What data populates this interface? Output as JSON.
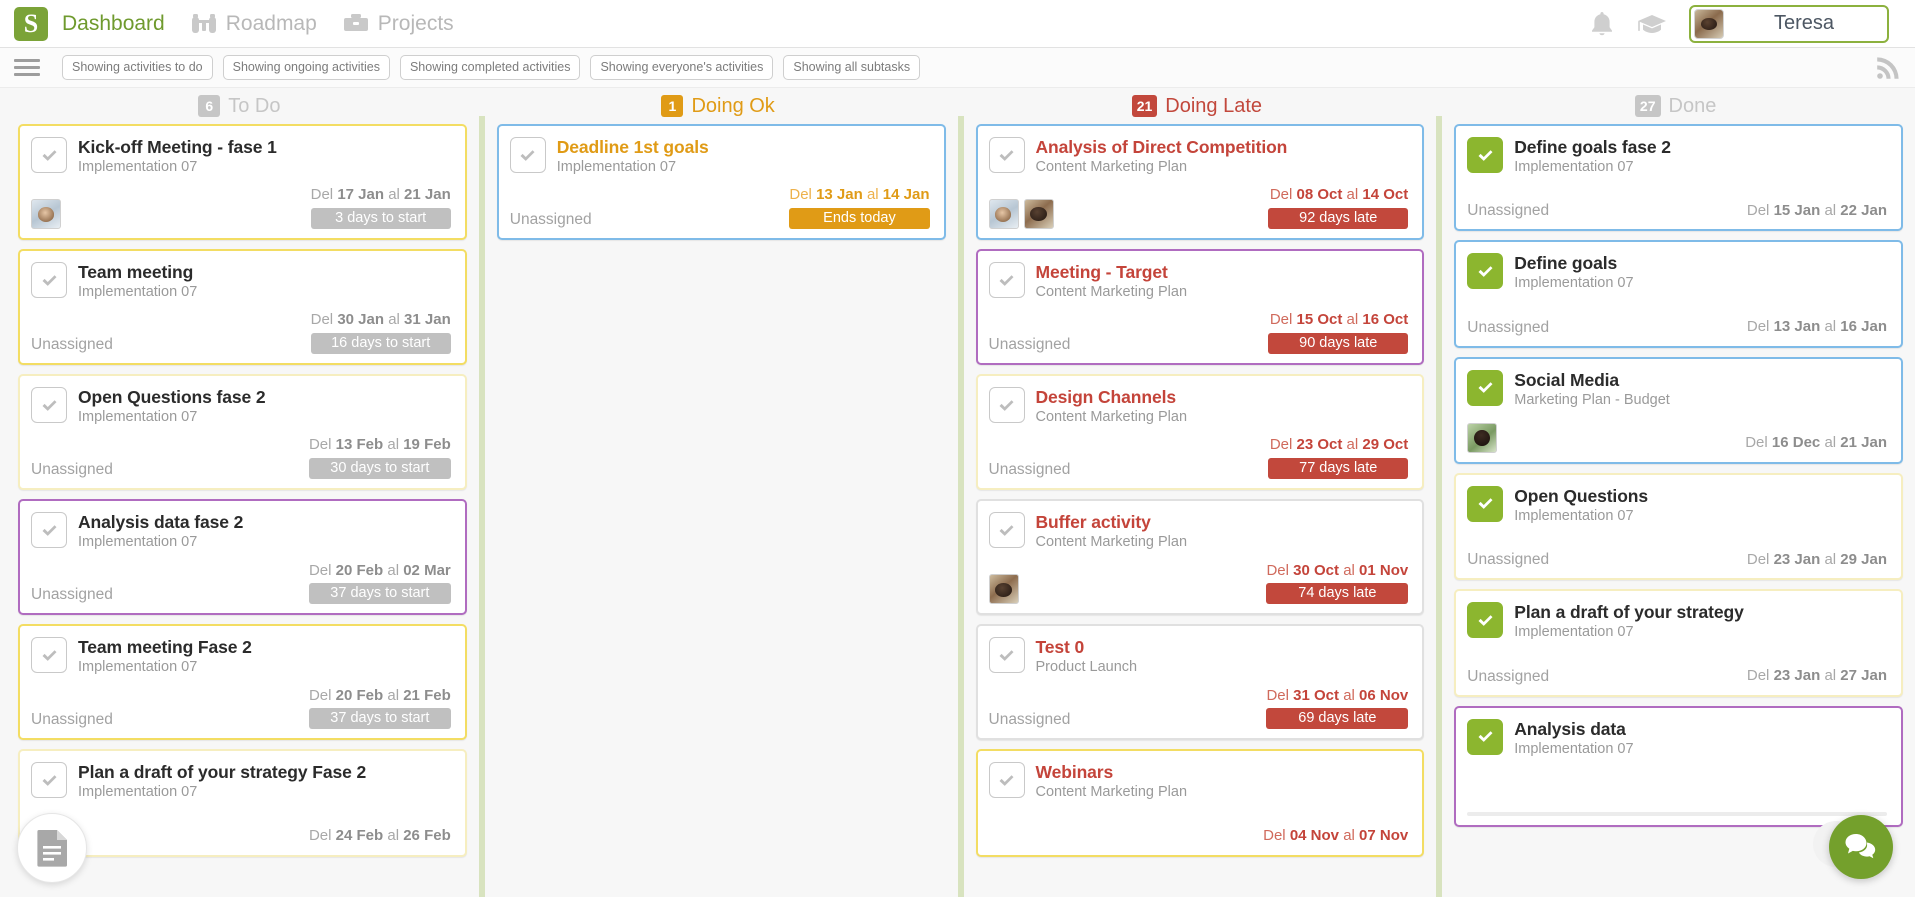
{
  "topnav": {
    "logo_text": "S",
    "items": [
      {
        "label": "Dashboard",
        "icon": "dashboard-logo-icon",
        "active": true
      },
      {
        "label": "Roadmap",
        "icon": "binoculars-icon",
        "active": false
      },
      {
        "label": "Projects",
        "icon": "briefcase-icon",
        "active": false
      }
    ],
    "bell_icon": "bell-icon",
    "graduation_icon": "graduation-cap-icon",
    "user_name": "Teresa"
  },
  "filterbar": {
    "menu_icon": "hamburger-menu-icon",
    "rss_icon": "rss-feed-icon",
    "chips": [
      "Showing activities to do",
      "Showing ongoing activities",
      "Showing completed activities",
      "Showing everyone's activities",
      "Showing all subtasks"
    ]
  },
  "colors": {
    "brand_green": "#7ba338",
    "todo_grey": "#c6c6c6",
    "doing_ok_orange": "#e09b16",
    "doing_late_red": "#c2483c",
    "done_grey": "#c6c6c6",
    "divider_green": "#d8e3bf"
  },
  "columns": [
    {
      "id": "to-do",
      "title": "To Do",
      "count": "6",
      "count_bg": "#c6c6c6",
      "title_color": "#c6c6c6",
      "cards": [
        {
          "title": "Kick-off Meeting - fase 1",
          "project": "Implementation 07",
          "title_tone": "normal",
          "border": "b-yellow",
          "checked": false,
          "assignees": [
            "av-a"
          ],
          "assigned_label": "",
          "date_prefix": "Del",
          "date_from": "17 Jan",
          "date_mid": "al",
          "date_to": "21 Jan",
          "date_tone": "normal",
          "badge": "3 days to start",
          "badge_tone": "grey"
        },
        {
          "title": "Team meeting",
          "project": "Implementation 07",
          "title_tone": "normal",
          "border": "b-yellow",
          "checked": false,
          "assignees": [],
          "assigned_label": "Unassigned",
          "date_prefix": "Del",
          "date_from": "30 Jan",
          "date_mid": "al",
          "date_to": "31 Jan",
          "date_tone": "normal",
          "badge": "16 days to start",
          "badge_tone": "grey"
        },
        {
          "title": "Open Questions fase 2",
          "project": "Implementation 07",
          "title_tone": "normal",
          "border": "b-paleyellow",
          "checked": false,
          "assignees": [],
          "assigned_label": "Unassigned",
          "date_prefix": "Del",
          "date_from": "13 Feb",
          "date_mid": "al",
          "date_to": "19 Feb",
          "date_tone": "normal",
          "badge": "30 days to start",
          "badge_tone": "grey"
        },
        {
          "title": "Analysis data fase 2",
          "project": "Implementation 07",
          "title_tone": "normal",
          "border": "b-purple",
          "checked": false,
          "assignees": [],
          "assigned_label": "Unassigned",
          "date_prefix": "Del",
          "date_from": "20 Feb",
          "date_mid": "al",
          "date_to": "02 Mar",
          "date_tone": "normal",
          "badge": "37 days to start",
          "badge_tone": "grey"
        },
        {
          "title": "Team meeting Fase 2",
          "project": "Implementation 07",
          "title_tone": "normal",
          "border": "b-yellow",
          "checked": false,
          "assignees": [],
          "assigned_label": "Unassigned",
          "date_prefix": "Del",
          "date_from": "20 Feb",
          "date_mid": "al",
          "date_to": "21 Feb",
          "date_tone": "normal",
          "badge": "37 days to start",
          "badge_tone": "grey"
        },
        {
          "title": "Plan a draft of your strategy Fase 2",
          "project": "Implementation 07",
          "title_tone": "normal",
          "border": "b-paleyellow",
          "checked": false,
          "assignees": [],
          "assigned_label": "",
          "date_prefix": "Del",
          "date_from": "24 Feb",
          "date_mid": "al",
          "date_to": "26 Feb",
          "date_tone": "normal",
          "badge": "",
          "badge_tone": "grey"
        }
      ]
    },
    {
      "id": "doing-ok",
      "title": "Doing Ok",
      "count": "1",
      "count_bg": "#e09b16",
      "title_color": "#e09b16",
      "cards": [
        {
          "title": "Deadline 1st goals",
          "project": "Implementation 07",
          "title_tone": "ok",
          "border": "b-blue",
          "checked": false,
          "assignees": [],
          "assigned_label": "Unassigned",
          "date_prefix": "Del",
          "date_from": "13 Jan",
          "date_mid": "al",
          "date_to": "14 Jan",
          "date_tone": "ok",
          "badge": "Ends today",
          "badge_tone": "orange"
        }
      ]
    },
    {
      "id": "doing-late",
      "title": "Doing Late",
      "count": "21",
      "count_bg": "#c2483c",
      "title_color": "#c2483c",
      "cards": [
        {
          "title": "Analysis of Direct Competition",
          "project": "Content Marketing Plan",
          "title_tone": "late",
          "border": "b-blue",
          "checked": false,
          "assignees": [
            "av-a",
            "av-b"
          ],
          "assigned_label": "",
          "date_prefix": "Del",
          "date_from": "08 Oct",
          "date_mid": "al",
          "date_to": "14 Oct",
          "date_tone": "late",
          "badge": "92 days late",
          "badge_tone": "red"
        },
        {
          "title": "Meeting - Target",
          "project": "Content Marketing Plan",
          "title_tone": "late",
          "border": "b-purple",
          "checked": false,
          "assignees": [],
          "assigned_label": "Unassigned",
          "date_prefix": "Del",
          "date_from": "15 Oct",
          "date_mid": "al",
          "date_to": "16 Oct",
          "date_tone": "late",
          "badge": "90 days late",
          "badge_tone": "red"
        },
        {
          "title": "Design Channels",
          "project": "Content Marketing Plan",
          "title_tone": "late",
          "border": "b-paleyellow",
          "checked": false,
          "assignees": [],
          "assigned_label": "Unassigned",
          "date_prefix": "Del",
          "date_from": "23 Oct",
          "date_mid": "al",
          "date_to": "29 Oct",
          "date_tone": "late",
          "badge": "77 days late",
          "badge_tone": "red"
        },
        {
          "title": "Buffer activity",
          "project": "Content Marketing Plan",
          "title_tone": "late",
          "border": "b-grey",
          "checked": false,
          "assignees": [
            "av-b"
          ],
          "assigned_label": "",
          "date_prefix": "Del",
          "date_from": "30 Oct",
          "date_mid": "al",
          "date_to": "01 Nov",
          "date_tone": "late",
          "badge": "74 days late",
          "badge_tone": "red"
        },
        {
          "title": "Test 0",
          "project": "Product Launch",
          "title_tone": "late",
          "border": "b-grey",
          "checked": false,
          "assignees": [],
          "assigned_label": "Unassigned",
          "date_prefix": "Del",
          "date_from": "31 Oct",
          "date_mid": "al",
          "date_to": "06 Nov",
          "date_tone": "late",
          "badge": "69 days late",
          "badge_tone": "red"
        },
        {
          "title": "Webinars",
          "project": "Content Marketing Plan",
          "title_tone": "late",
          "border": "b-yellow",
          "checked": false,
          "assignees": [],
          "assigned_label": "",
          "date_prefix": "Del",
          "date_from": "04 Nov",
          "date_mid": "al",
          "date_to": "07 Nov",
          "date_tone": "late",
          "badge": "",
          "badge_tone": "red"
        }
      ]
    },
    {
      "id": "done",
      "title": "Done",
      "count": "27",
      "count_bg": "#c6c6c6",
      "title_color": "#c6c6c6",
      "cards": [
        {
          "title": "Define goals fase 2",
          "project": "Implementation 07",
          "title_tone": "normal",
          "border": "b-blue",
          "checked": true,
          "assignees": [],
          "assigned_label": "Unassigned",
          "date_prefix": "Del",
          "date_from": "15 Jan",
          "date_mid": "al",
          "date_to": "22 Jan",
          "date_tone": "normal",
          "badge": "",
          "badge_tone": "grey"
        },
        {
          "title": "Define goals",
          "project": "Implementation 07",
          "title_tone": "normal",
          "border": "b-blue",
          "checked": true,
          "assignees": [],
          "assigned_label": "Unassigned",
          "date_prefix": "Del",
          "date_from": "13 Jan",
          "date_mid": "al",
          "date_to": "16 Jan",
          "date_tone": "normal",
          "badge": "",
          "badge_tone": "grey"
        },
        {
          "title": "Social Media",
          "project": "Marketing Plan - Budget",
          "title_tone": "normal",
          "border": "b-blue",
          "checked": true,
          "assignees": [
            "av-c"
          ],
          "assigned_label": "",
          "date_prefix": "Del",
          "date_from": "16 Dec",
          "date_mid": "al",
          "date_to": "21 Jan",
          "date_tone": "normal",
          "badge": "",
          "badge_tone": "grey"
        },
        {
          "title": "Open Questions",
          "project": "Implementation 07",
          "title_tone": "normal",
          "border": "b-paleyellow",
          "checked": true,
          "assignees": [],
          "assigned_label": "Unassigned",
          "date_prefix": "Del",
          "date_from": "23 Jan",
          "date_mid": "al",
          "date_to": "29 Jan",
          "date_tone": "normal",
          "badge": "",
          "badge_tone": "grey"
        },
        {
          "title": "Plan a draft of your strategy",
          "project": "Implementation 07",
          "title_tone": "normal",
          "border": "b-paleyellow",
          "checked": true,
          "assignees": [],
          "assigned_label": "Unassigned",
          "date_prefix": "Del",
          "date_from": "23 Jan",
          "date_mid": "al",
          "date_to": "27 Jan",
          "date_tone": "normal",
          "badge": "",
          "badge_tone": "grey"
        },
        {
          "title": "Analysis data",
          "project": "Implementation 07",
          "title_tone": "normal",
          "border": "b-purple",
          "checked": true,
          "assignees": [],
          "assigned_label": "",
          "date_prefix": "",
          "date_from": "",
          "date_mid": "",
          "date_to": "",
          "date_tone": "normal",
          "badge": "",
          "badge_tone": "grey"
        }
      ]
    }
  ],
  "fab": {
    "document_icon": "document-icon",
    "chat_icon": "chat-bubble-icon"
  }
}
